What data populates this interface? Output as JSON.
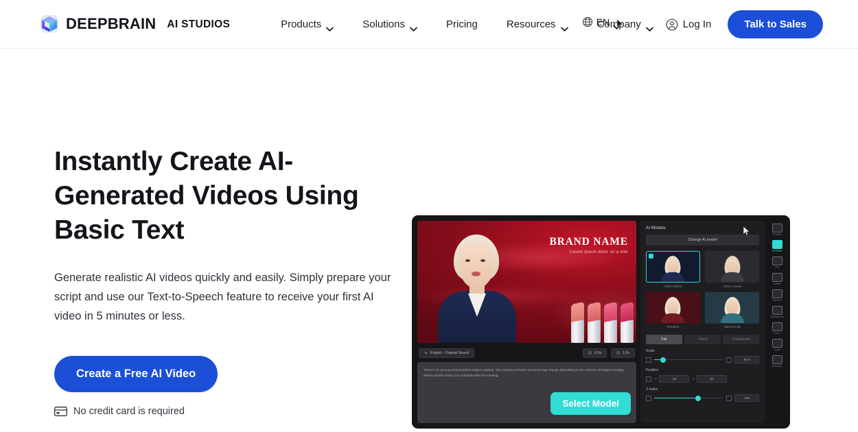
{
  "header": {
    "brand": {
      "name": "DEEPBRAIN",
      "suffix": "AI STUDIOS",
      "logo_icon": "cube-logo-icon"
    },
    "nav": [
      {
        "label": "Products",
        "has_caret": true
      },
      {
        "label": "Solutions",
        "has_caret": true
      },
      {
        "label": "Pricing",
        "has_caret": false
      },
      {
        "label": "Resources",
        "has_caret": true
      },
      {
        "label": "Company",
        "has_caret": true
      }
    ],
    "language": {
      "label": "EN",
      "icon": "globe-icon"
    },
    "login": {
      "label": "Log In",
      "icon": "user-circle-icon"
    },
    "cta": {
      "label": "Talk to Sales",
      "color": "#1c4fd8"
    }
  },
  "hero": {
    "headline": "Instantly Create AI-Generated Videos Using Basic Text",
    "subcopy": "Generate realistic AI videos quickly and easily. Simply prepare your script and use our Text-to-Speech feature to receive your first AI video in 5 minutes or less.",
    "cta": {
      "label": "Create a Free AI Video",
      "color": "#1c4fd8"
    },
    "note": {
      "label": "No credit card is required",
      "icon": "credit-card-icon"
    }
  },
  "app_preview": {
    "stage": {
      "brand_name": "BRAND NAME",
      "brand_tagline": "Lorem ipsum dolor sit a met"
    },
    "toolbar": {
      "language_pill": "English - Original Sound",
      "duration_pill": "0.0s",
      "speed_pill": "1.0x"
    },
    "script_text": "There is an announcement before today's meeting. The morning schedule tomorrow may change depending on the outcome of today's meeting. Please double-check your schedule after the meeting.",
    "select_model_button": {
      "label": "Select Model",
      "color": "#31dcd5"
    },
    "models_panel": {
      "title": "AI Models",
      "change_button": "Change AI model",
      "thumbnails": [
        {
          "label": "Olivia Sabine",
          "selected": true,
          "hair": "#e9dcc6",
          "bg": "#121a2e",
          "body": "#1e2a52"
        },
        {
          "label": "Jenny Casual",
          "selected": false,
          "hair": "#e3d4bb",
          "bg": "#2a2a30",
          "body": "#3c3c44"
        },
        {
          "label": "Rosanna",
          "selected": false,
          "hair": "#f0e3cd",
          "bg": "#4a1018",
          "body": "#6d1a22"
        },
        {
          "label": "Samuel Lab",
          "selected": false,
          "hair": "#ece0c8",
          "bg": "#243b45",
          "body": "#35707f"
        }
      ],
      "tabs": [
        {
          "label": "Full",
          "active": true
        },
        {
          "label": "Chest",
          "active": false
        },
        {
          "label": "Transparent",
          "active": false
        }
      ],
      "controls": [
        {
          "name": "Scale",
          "type": "slider",
          "value": "49 %",
          "fill_pct": 12
        },
        {
          "name": "Position",
          "type": "xy",
          "x_label": "X",
          "x_value": "-24",
          "y_label": "Y",
          "y_value": "61"
        },
        {
          "name": "Z-index",
          "type": "slider",
          "value": "434",
          "fill_pct": 62
        }
      ]
    },
    "rail": [
      {
        "label": "Template",
        "icon": "template-icon",
        "active": false
      },
      {
        "label": "AI Model",
        "icon": "ai-model-icon",
        "active": true
      },
      {
        "label": "Text",
        "icon": "text-icon",
        "active": false
      },
      {
        "label": "Subtitle",
        "icon": "subtitle-icon",
        "active": false
      },
      {
        "label": "Element",
        "icon": "element-icon",
        "active": false
      },
      {
        "label": "Background",
        "icon": "background-icon",
        "active": false
      },
      {
        "label": "Frame",
        "icon": "frame-icon",
        "active": false
      },
      {
        "label": "Audio",
        "icon": "audio-icon",
        "active": false
      },
      {
        "label": "Branding",
        "icon": "branding-icon",
        "active": false
      }
    ]
  }
}
